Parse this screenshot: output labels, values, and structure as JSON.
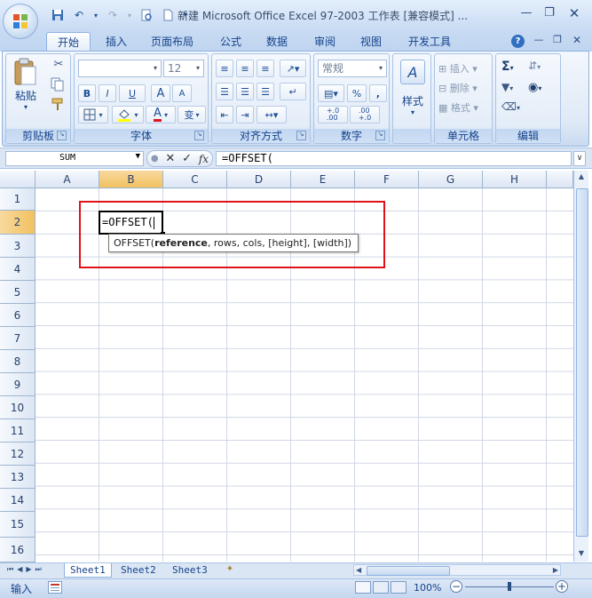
{
  "window": {
    "title": "新建 Microsoft Office Excel 97-2003 工作表 [兼容模式] ...",
    "controls": [
      "minimize-icon",
      "restore-icon",
      "close-icon"
    ]
  },
  "quick_access": [
    "save-icon",
    "undo-icon",
    "redo-icon",
    "print-preview-icon",
    "new-icon"
  ],
  "ribbon_tabs": [
    "开始",
    "插入",
    "页面布局",
    "公式",
    "数据",
    "审阅",
    "视图",
    "开发工具"
  ],
  "active_tab": "开始",
  "ribbon": {
    "clipboard": {
      "label": "剪贴板",
      "paste_label": "粘贴"
    },
    "font": {
      "label": "字体",
      "font_name": "",
      "font_size": "12",
      "bold": "B",
      "italic": "I",
      "underline": "U",
      "grow": "A",
      "shrink": "A",
      "phonetic": "变"
    },
    "alignment": {
      "label": "对齐方式"
    },
    "number": {
      "label": "数字",
      "format": "常规",
      "percent": "%",
      "comma": ",",
      "inc_decimal": "+.0\n.00",
      "dec_decimal": ".00\n+.0"
    },
    "styles": {
      "label": "样式",
      "button": "样式"
    },
    "cells": {
      "label": "单元格",
      "insert": "插入",
      "delete": "删除",
      "format": "格式"
    },
    "editing": {
      "label": "编辑"
    }
  },
  "formula_bar": {
    "name_box": "SUM",
    "fx": "fx",
    "formula": "=OFFSET("
  },
  "columns": [
    "A",
    "B",
    "C",
    "D",
    "E",
    "F",
    "G",
    "H"
  ],
  "selected_column": "B",
  "rows": [
    "1",
    "2",
    "3",
    "4",
    "5",
    "6",
    "7",
    "8",
    "9",
    "10",
    "11",
    "12",
    "13",
    "14",
    "15",
    "16"
  ],
  "selected_row": "2",
  "active_cell": {
    "ref": "B2",
    "content": "=OFFSET("
  },
  "tooltip": {
    "fn": "OFFSET(",
    "arg_bold": "reference",
    "rest": ", rows, cols, [height], [width])"
  },
  "sheets": [
    "Sheet1",
    "Sheet2",
    "Sheet3"
  ],
  "active_sheet": "Sheet1",
  "status": {
    "mode": "输入",
    "zoom": "100%"
  },
  "colors": {
    "accent": "#15428b",
    "selected_header": "#f1c15f",
    "highlight_box": "#e0121a",
    "ribbon_bg": "#dfe9f6"
  }
}
